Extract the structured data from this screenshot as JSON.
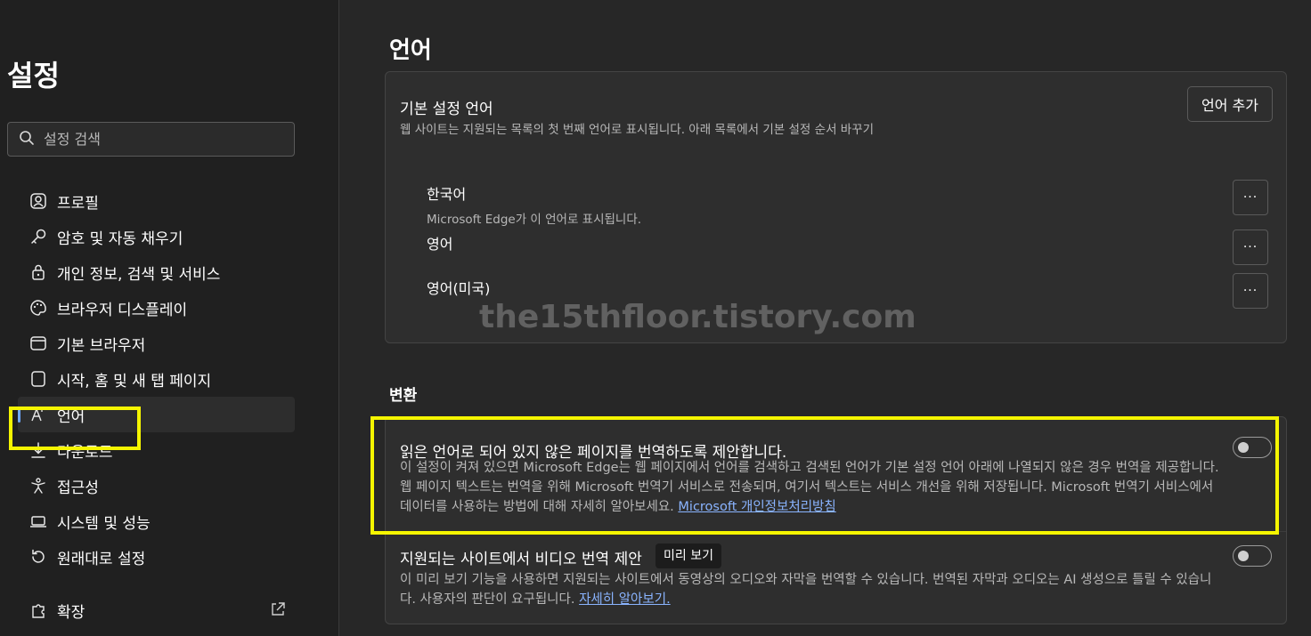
{
  "sidebar": {
    "title": "설정",
    "search_placeholder": "설정 검색",
    "items": [
      {
        "label": "프로필",
        "icon": "profile-icon"
      },
      {
        "label": "암호 및 자동 채우기",
        "icon": "key-icon"
      },
      {
        "label": "개인 정보, 검색 및 서비스",
        "icon": "lock-icon"
      },
      {
        "label": "브라우저 디스플레이",
        "icon": "palette-icon"
      },
      {
        "label": "기본 브라우저",
        "icon": "browser-icon"
      },
      {
        "label": "시작, 홈 및 새 탭 페이지",
        "icon": "page-icon"
      },
      {
        "label": "언어",
        "icon": "language-icon",
        "active": true
      },
      {
        "label": "다운로드",
        "icon": "download-icon"
      },
      {
        "label": "접근성",
        "icon": "accessibility-icon"
      },
      {
        "label": "시스템 및 성능",
        "icon": "laptop-icon"
      },
      {
        "label": "원래대로 설정",
        "icon": "reset-icon"
      },
      {
        "label": "확장",
        "icon": "extension-icon"
      }
    ]
  },
  "main": {
    "title": "언어",
    "preferred": {
      "title": "기본 설정 언어",
      "description": "웹 사이트는 지원되는 목록의 첫 번째 언어로 표시됩니다. 아래 목록에서 기본 설정 순서 바꾸기",
      "add_button": "언어 추가",
      "languages": [
        {
          "name": "한국어",
          "note": "Microsoft Edge가 이 언어로 표시됩니다."
        },
        {
          "name": "영어",
          "note": ""
        },
        {
          "name": "영어(미국)",
          "note": ""
        }
      ],
      "more_label": "···"
    },
    "watermark": "the15thfloor.tistory.com",
    "translation": {
      "section_title": "변환",
      "offer_translate": {
        "title": "읽은 언어로 되어 있지 않은 페이지를 번역하도록 제안합니다.",
        "description_1": "이 설정이 켜져 있으면 Microsoft Edge는 웹 페이지에서 언어를 검색하고 검색된 언어가 기본 설정 언어 아래에 나열되지 않은 경우 번역을 제공합니다.",
        "description_2": "웹 페이지 텍스트는 번역을 위해 Microsoft 번역기 서비스로 전송되며, 여기서 텍스트는 서비스 개선을 위해 저장됩니다. Microsoft 번역기 서비스에서",
        "description_3": "데이터를 사용하는 방법에 대해 자세히 알아보세요.",
        "link": "Microsoft 개인정보처리방침",
        "enabled": false
      },
      "video_translate": {
        "title": "지원되는 사이트에서 비디오 번역 제안",
        "badge": "미리 보기",
        "description_1": "이 미리 보기 기능을 사용하면 지원되는 사이트에서 동영상의 오디오와 자막을 번역할 수 있습니다. 번역된 자막과 오디오는 AI 생성으로 틀릴 수 있습니",
        "description_2": "다. 사용자의 판단이 요구됩니다.",
        "link": "자세히 알아보기.",
        "enabled": false
      }
    }
  },
  "colors": {
    "highlight": "#f5f500",
    "link": "#8ab4ff",
    "active_indicator": "#6fa8ff"
  }
}
